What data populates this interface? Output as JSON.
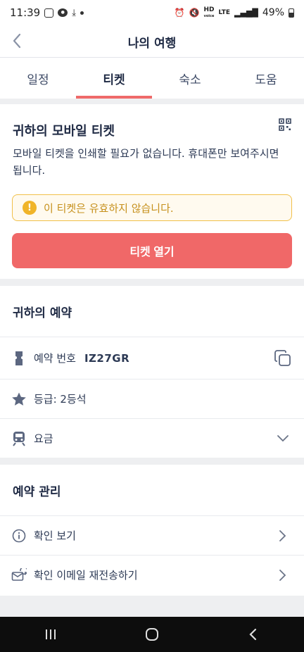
{
  "status": {
    "time": "11:39",
    "hd": "HD",
    "voice": "voice",
    "lte": "LTE",
    "battery_text": "49%"
  },
  "header": {
    "title": "나의 여행"
  },
  "tabs": [
    {
      "label": "일정",
      "active": false
    },
    {
      "label": "티켓",
      "active": true
    },
    {
      "label": "숙소",
      "active": false
    },
    {
      "label": "도움",
      "active": false
    }
  ],
  "ticket": {
    "title": "귀하의 모바일 티켓",
    "description": "모바일 티켓을 인쇄할 필요가 없습니다. 휴대폰만 보여주시면 됩니다.",
    "alert_icon": "!",
    "alert_text": "이 티켓은 유효하지 않습니다.",
    "open_button": "티켓 열기"
  },
  "booking": {
    "title": "귀하의 예약",
    "reference_label": "예약 번호",
    "reference_code": "IZ27GR",
    "class_text": "등급: 2등석",
    "fare_label": "요금"
  },
  "manage": {
    "title": "예약 관리",
    "view_confirmation": "확인 보기",
    "resend_email": "확인 이메일 재전송하기"
  },
  "colors": {
    "accent": "#f06868",
    "navy": "#1f2a44",
    "alert_border": "#f1c04a",
    "alert_text": "#c6901c"
  },
  "icons": [
    "back-arrow-icon",
    "qr-code-icon",
    "info-icon",
    "ticket-icon",
    "copy-icon",
    "star-icon",
    "train-icon",
    "chevron-down-icon",
    "info-circle-icon",
    "email-resend-icon",
    "chevron-right-icon"
  ]
}
